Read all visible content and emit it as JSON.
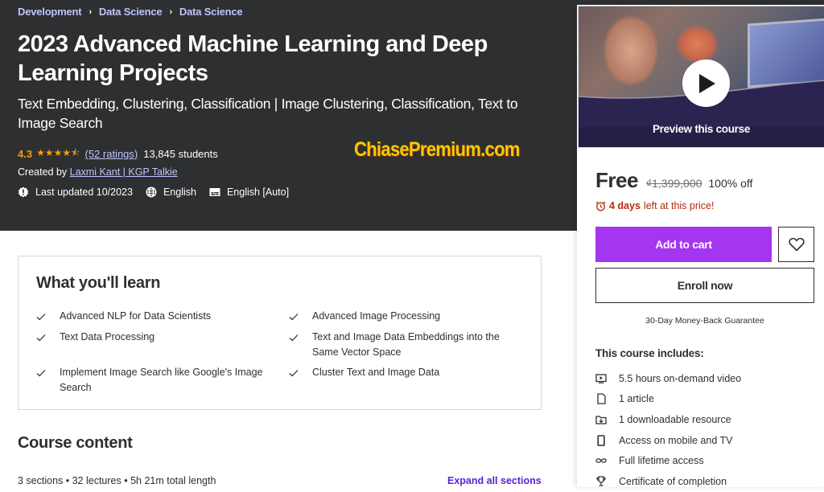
{
  "breadcrumb": [
    {
      "label": "Development"
    },
    {
      "label": "Data Science"
    },
    {
      "label": "Data Science"
    }
  ],
  "course": {
    "title": "2023 Advanced Machine Learning and Deep Learning Projects",
    "subtitle": "Text Embedding, Clustering, Classification | Image Clustering, Classification, Text to Image Search",
    "rating": "4.3",
    "rating_stars": 4.3,
    "stars_glyph": "★★★★⯪",
    "ratings_count": "(52 ratings)",
    "students": "13,845 students",
    "created_by_label": "Created by",
    "instructors": "Laxmi Kant | KGP Talkie",
    "last_updated": "Last updated 10/2023",
    "language": "English",
    "captions": "English [Auto]"
  },
  "watermark": "ChiasePremium.com",
  "sidebar": {
    "preview_label": "Preview this course",
    "price": "Free",
    "original_price": "₫1,399,000",
    "discount": "100% off",
    "timer_bold": "4 days",
    "timer_rest": "left at this price!",
    "add_to_cart": "Add to cart",
    "enroll_now": "Enroll now",
    "guarantee": "30-Day Money-Back Guarantee",
    "includes_title": "This course includes:",
    "includes": [
      {
        "icon": "video-icon",
        "label": "5.5 hours on-demand video"
      },
      {
        "icon": "article-icon",
        "label": "1 article"
      },
      {
        "icon": "download-folder-icon",
        "label": "1 downloadable resource"
      },
      {
        "icon": "mobile-icon",
        "label": "Access on mobile and TV"
      },
      {
        "icon": "infinity-icon",
        "label": "Full lifetime access"
      },
      {
        "icon": "trophy-icon",
        "label": "Certificate of completion"
      }
    ]
  },
  "learn": {
    "title": "What you'll learn",
    "items": [
      "Advanced NLP for Data Scientists",
      "Advanced Image Processing",
      "Text Data Processing",
      "Text and Image Data Embeddings into the Same Vector Space",
      "Implement Image Search like Google's Image Search",
      "Cluster Text and Image Data"
    ]
  },
  "course_content": {
    "title": "Course content",
    "stats": "3 sections • 32 lectures • 5h 21m total length",
    "expand_all": "Expand all sections"
  },
  "colors": {
    "hero_bg": "#2d2f31",
    "accent_purple": "#a435f0",
    "link_purple": "#5624d0",
    "link_light": "#c0c4fc",
    "star_orange": "#f69c08",
    "timer_red": "#b32d0f",
    "watermark_yellow": "#ffc800"
  }
}
